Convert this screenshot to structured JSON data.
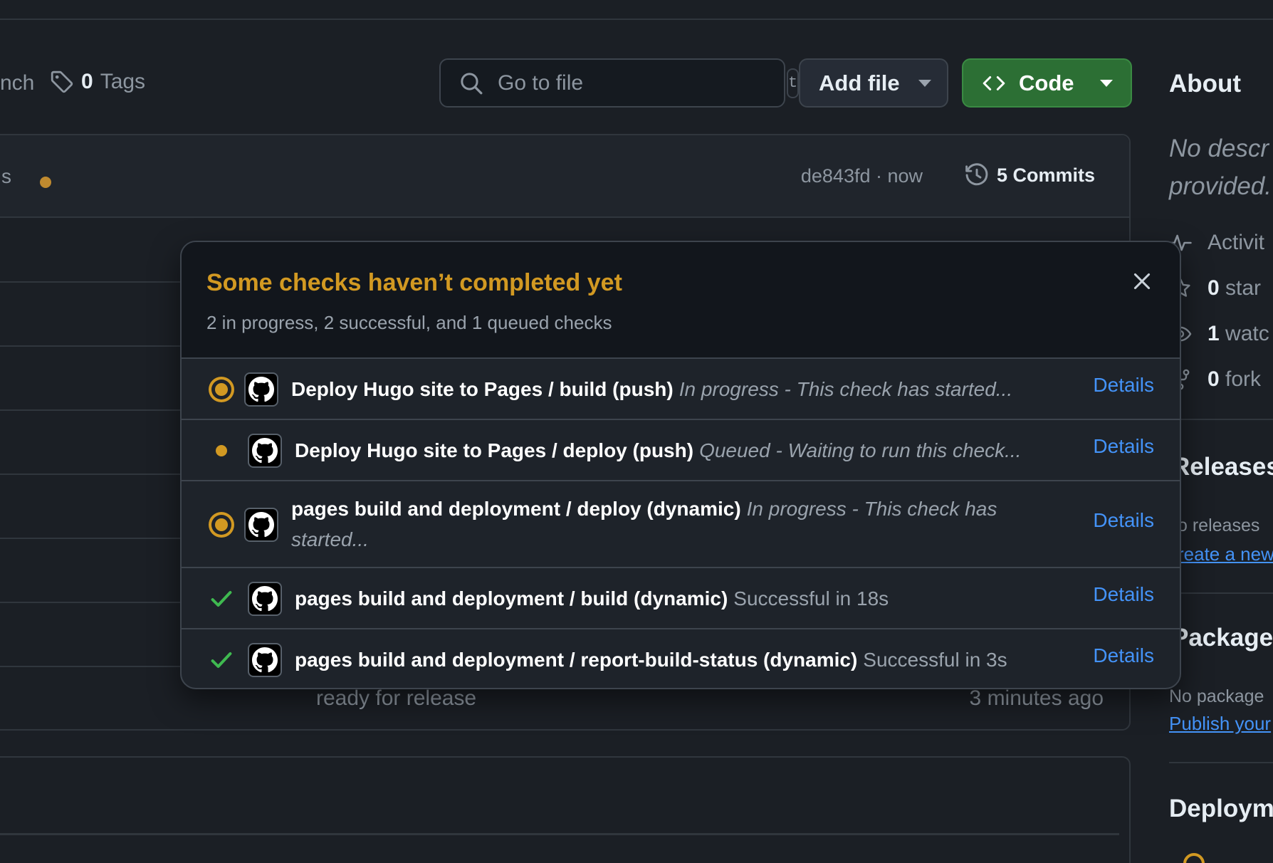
{
  "toolbar": {
    "branch_fragment": "nch",
    "tags_count": "0",
    "tags_label": "Tags",
    "search_placeholder": "Go to file",
    "search_shortcut": "t",
    "add_file_label": "Add file",
    "code_label": "Code",
    "colors": {
      "code_button": "#2c6f34"
    }
  },
  "commit_bar": {
    "fragment": "s",
    "meta": "de843fd · now",
    "commits_label": "5 Commits"
  },
  "file_rows": {
    "last_message": "ready for release",
    "last_time": "3 minutes ago"
  },
  "sidebar": {
    "about_title": "About",
    "about_description": [
      "No descr",
      "provided."
    ],
    "stats": [
      {
        "icon": "pulse-icon",
        "value": "",
        "label": "Activit"
      },
      {
        "icon": "star-icon",
        "value": "0",
        "label": "star"
      },
      {
        "icon": "eye-icon",
        "value": "1",
        "label": "watc"
      },
      {
        "icon": "fork-icon",
        "value": "0",
        "label": "fork"
      }
    ],
    "releases_heading": "Releases",
    "releases_text": "o releases",
    "releases_link": "reate a new",
    "packages_heading": "Packages",
    "packages_text": "No package",
    "packages_link": "Publish your",
    "deployments_heading": "Deploym"
  },
  "checks_popover": {
    "title": "Some checks haven’t completed yet",
    "subtitle": "2 in progress, 2 successful, and 1 queued checks",
    "colors": {
      "pending": "#d29922",
      "success": "#3fb950",
      "link": "#4493f8"
    },
    "checks": [
      {
        "state": "in-progress",
        "name": "Deploy Hugo site to Pages / build (push)",
        "status": "In progress - This check has started...",
        "details": "Details"
      },
      {
        "state": "queued",
        "name": "Deploy Hugo site to Pages / deploy (push)",
        "status": "Queued - Waiting to run this check...",
        "details": "Details"
      },
      {
        "state": "in-progress",
        "name": "pages build and deployment / deploy (dynamic)",
        "status": "In progress - This check has started...",
        "details": "Details"
      },
      {
        "state": "success",
        "name": "pages build and deployment / build (dynamic)",
        "status": "Successful in 18s",
        "details": "Details"
      },
      {
        "state": "success",
        "name": "pages build and deployment / report-build-status (dynamic)",
        "status": "Successful in 3s",
        "details": "Details"
      }
    ]
  }
}
